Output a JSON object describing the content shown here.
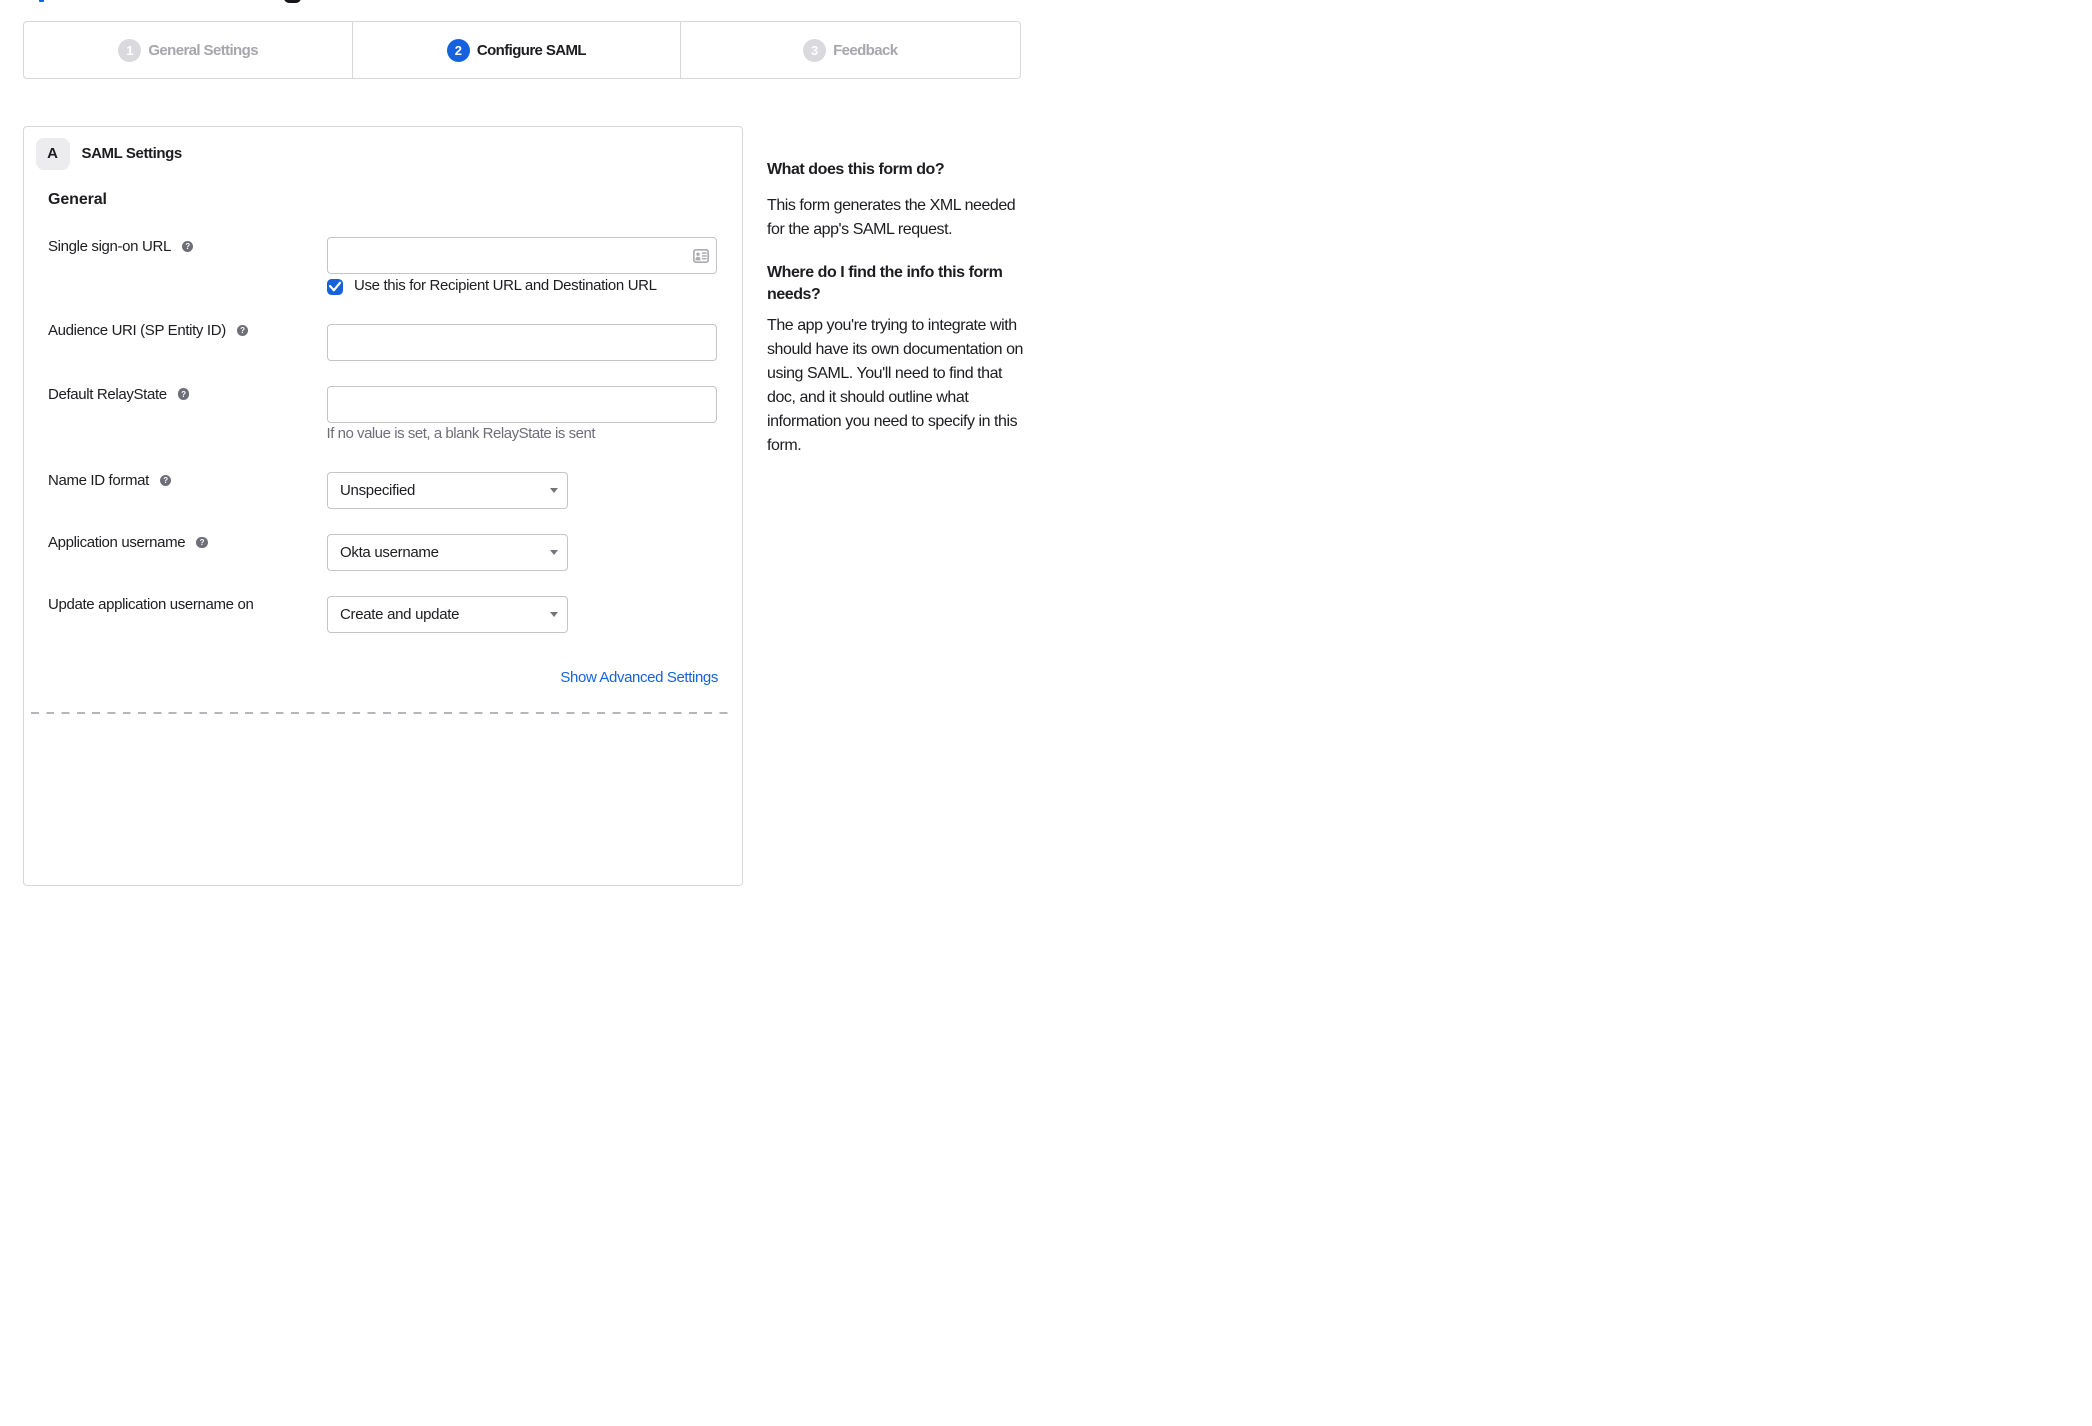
{
  "stepper": {
    "steps": [
      {
        "number": "1",
        "label": "General Settings",
        "state": "inactive"
      },
      {
        "number": "2",
        "label": "Configure SAML",
        "state": "active"
      },
      {
        "number": "3",
        "label": "Feedback",
        "state": "inactive"
      }
    ]
  },
  "form": {
    "section_badge": "A",
    "section_title": "SAML Settings",
    "group_heading": "General",
    "fields": {
      "single_sign_on_url": {
        "label": "Single sign-on URL",
        "value": "",
        "checkbox_label": "Use this for Recipient URL and Destination URL",
        "checkbox_checked": true
      },
      "audience_uri": {
        "label": "Audience URI (SP Entity ID)",
        "value": ""
      },
      "default_relay_state": {
        "label": "Default RelayState",
        "value": "",
        "helper": "If no value is set, a blank RelayState is sent"
      },
      "name_id_format": {
        "label": "Name ID format",
        "value": "Unspecified"
      },
      "application_username": {
        "label": "Application username",
        "value": "Okta username"
      },
      "update_application_username_on": {
        "label": "Update application username on",
        "value": "Create and update"
      }
    },
    "advanced_link": "Show Advanced Settings"
  },
  "sidebar": {
    "sections": [
      {
        "heading": "What does this form do?",
        "body": "This form generates the XML needed for the app's SAML request."
      },
      {
        "heading": "Where do I find the info this form needs?",
        "body": "The app you're trying to integrate with should have its own documentation on using SAML. You'll need to find that doc, and it should outline what information you need to specify in this form."
      }
    ]
  },
  "colors": {
    "accent_blue": "#1662dd",
    "text_primary": "#1d1d21",
    "text_inactive": "#a3a3aa",
    "border": "#d7d7dc"
  }
}
